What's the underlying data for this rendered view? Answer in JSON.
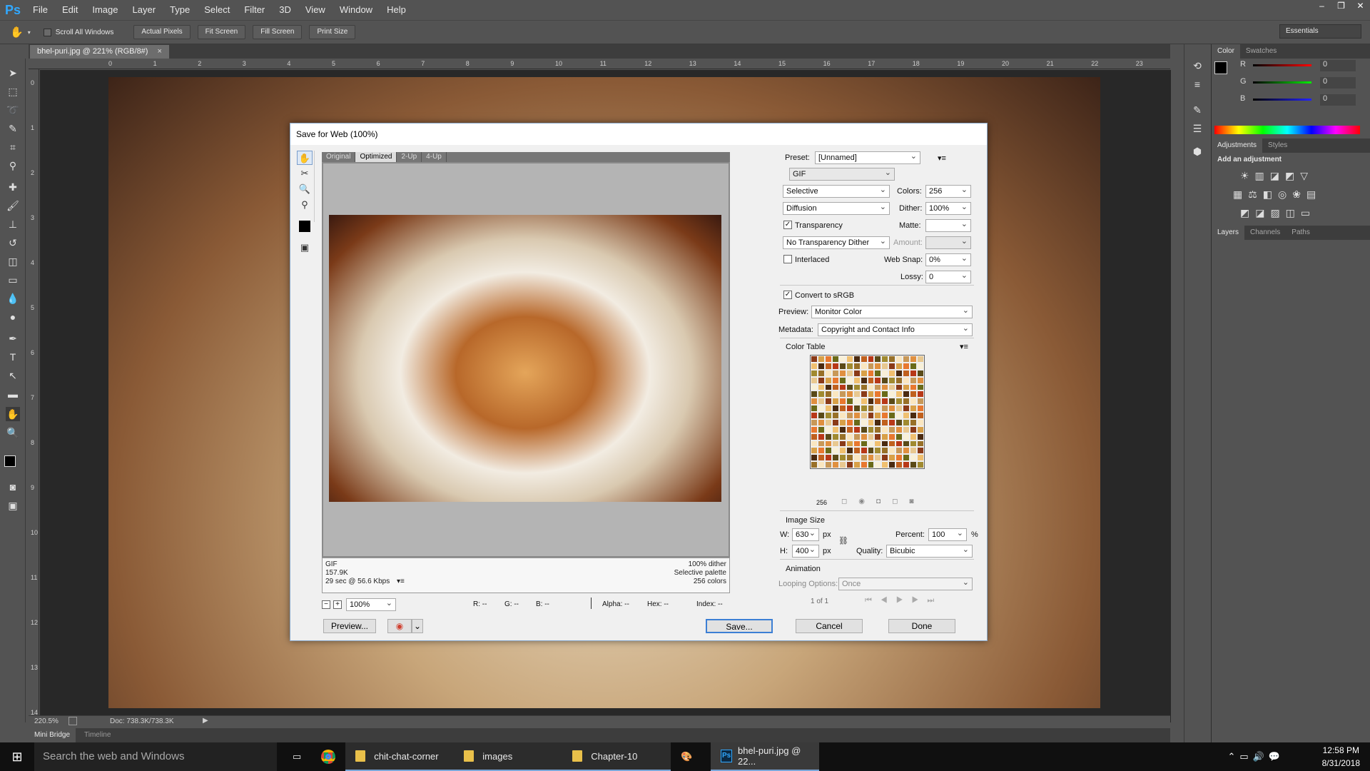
{
  "app": {
    "logo": "Ps"
  },
  "menu": [
    "File",
    "Edit",
    "Image",
    "Layer",
    "Type",
    "Select",
    "Filter",
    "3D",
    "View",
    "Window",
    "Help"
  ],
  "options_bar": {
    "scroll_all_windows": "Scroll All Windows",
    "buttons": [
      "Actual Pixels",
      "Fit Screen",
      "Fill Screen",
      "Print Size"
    ],
    "workspace": "Essentials"
  },
  "document": {
    "tab_title": "bhel-puri.jpg @ 221% (RGB/8#)",
    "zoom": "220.5%",
    "doc_size": "Doc: 738.3K/738.3K"
  },
  "ruler_h": [
    "0",
    "1",
    "2",
    "3",
    "4",
    "5",
    "6",
    "7",
    "8",
    "9",
    "10",
    "11",
    "12",
    "13",
    "14",
    "15",
    "16",
    "17",
    "18",
    "19",
    "20",
    "21",
    "22",
    "23"
  ],
  "ruler_v": [
    "0",
    "1",
    "2",
    "3",
    "4",
    "5",
    "6",
    "7",
    "8",
    "9",
    "10",
    "11",
    "12",
    "13",
    "14"
  ],
  "bottom_tabs": [
    "Mini Bridge",
    "Timeline"
  ],
  "right_panel": {
    "color_tabs": [
      "Color",
      "Swatches"
    ],
    "channels": [
      {
        "label": "R",
        "value": "0",
        "color": "#ff2020"
      },
      {
        "label": "G",
        "value": "0",
        "color": "#20e020"
      },
      {
        "label": "B",
        "value": "0",
        "color": "#2040ff"
      }
    ],
    "adj_tabs": [
      "Adjustments",
      "Styles"
    ],
    "adj_title": "Add an adjustment",
    "layer_tabs": [
      "Layers",
      "Channels",
      "Paths"
    ]
  },
  "dialog": {
    "title": "Save for Web (100%)",
    "view_tabs": [
      "Original",
      "Optimized",
      "2-Up",
      "4-Up"
    ],
    "info_left": [
      "GIF",
      "157.9K",
      "29 sec @ 56.6 Kbps"
    ],
    "info_right": [
      "100% dither",
      "Selective palette",
      "256 colors"
    ],
    "zoom": "100%",
    "readout": {
      "r": "R: --",
      "g": "G: --",
      "b": "B: --",
      "alpha": "Alpha: --",
      "hex": "Hex: --",
      "index": "Index: --"
    },
    "preset_label": "Preset:",
    "preset": "[Unnamed]",
    "format": "GIF",
    "reduction": "Selective",
    "colors_label": "Colors:",
    "colors": "256",
    "dither_algo": "Diffusion",
    "dither_label": "Dither:",
    "dither": "100%",
    "transparency": "Transparency",
    "matte_label": "Matte:",
    "transparency_dither": "No Transparency Dither",
    "amount_label": "Amount:",
    "interlaced": "Interlaced",
    "websnap_label": "Web Snap:",
    "websnap": "0%",
    "lossy_label": "Lossy:",
    "lossy": "0",
    "convert_srgb": "Convert to sRGB",
    "preview_label": "Preview:",
    "preview": "Monitor Color",
    "metadata_label": "Metadata:",
    "metadata": "Copyright and Contact Info",
    "color_table_title": "Color Table",
    "color_count": "256",
    "image_size_title": "Image Size",
    "w_label": "W:",
    "w": "630",
    "h_label": "H:",
    "h": "400",
    "px": "px",
    "percent_label": "Percent:",
    "percent": "100",
    "pct": "%",
    "quality_label": "Quality:",
    "quality": "Bicubic",
    "animation_title": "Animation",
    "looping_label": "Looping Options:",
    "looping": "Once",
    "frame": "1 of 1",
    "buttons": {
      "preview": "Preview...",
      "save": "Save...",
      "cancel": "Cancel",
      "done": "Done"
    }
  },
  "taskbar": {
    "search": "Search the web and Windows",
    "items": [
      "chit-chat-corner",
      "images",
      "Chapter-10",
      "bhel-puri.jpg @ 22..."
    ],
    "time": "12:58 PM",
    "date": "8/31/2018"
  }
}
